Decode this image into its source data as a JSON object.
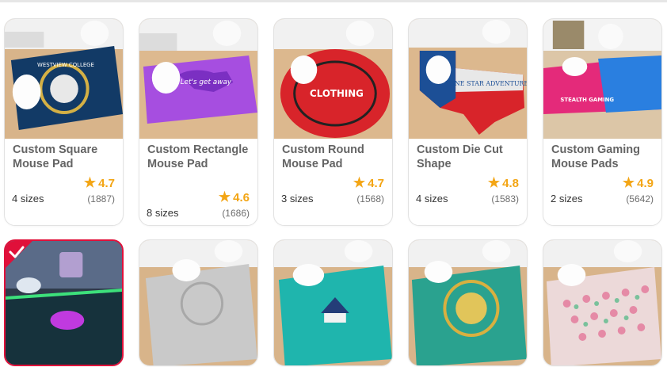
{
  "products": [
    {
      "title": "Custom Square Mouse Pad",
      "sizes": "4 sizes",
      "rating": "4.7",
      "reviews": "(1887)",
      "pad_color": "#123a66",
      "pad_text": "WESTVIEW COLLEGE"
    },
    {
      "title": "Custom Rectangle Mouse Pad",
      "sizes": "8 sizes",
      "rating": "4.6",
      "reviews": "(1686)",
      "pad_color": "#a64ee0",
      "pad_text": "Let's get away"
    },
    {
      "title": "Custom Round Mouse Pad",
      "sizes": "3 sizes",
      "rating": "4.7",
      "reviews": "(1568)",
      "pad_color": "#d8242a",
      "pad_text": "CLOTHING"
    },
    {
      "title": "Custom Die Cut Shape",
      "sizes": "4 sizes",
      "rating": "4.8",
      "reviews": "(1583)",
      "pad_color": "#1c4f96",
      "pad_text": "LONE STAR ADVENTURE"
    },
    {
      "title": "Custom Gaming Mouse Pads",
      "sizes": "2 sizes",
      "rating": "4.9",
      "reviews": "(5642)",
      "pad_color": "#e42a7a",
      "pad_text": "STEALTH GAMING"
    }
  ],
  "row2": [
    {
      "name": "rgb-gaming-pad",
      "pad_color": "#16323c",
      "selected": true
    },
    {
      "name": "gray-pad",
      "pad_color": "#c9c9c9",
      "selected": false
    },
    {
      "name": "teal-pad",
      "pad_color": "#1fb5ad",
      "selected": false
    },
    {
      "name": "green-round-pad",
      "pad_color": "#2aa28f",
      "selected": false
    },
    {
      "name": "pink-pattern-pad",
      "pad_color": "#ecd9d9",
      "selected": false
    }
  ],
  "colors": {
    "star": "#f3a514",
    "selected_border": "#e0103a",
    "title": "#646464"
  },
  "icons": {
    "star": "star-icon",
    "check": "check-icon"
  }
}
